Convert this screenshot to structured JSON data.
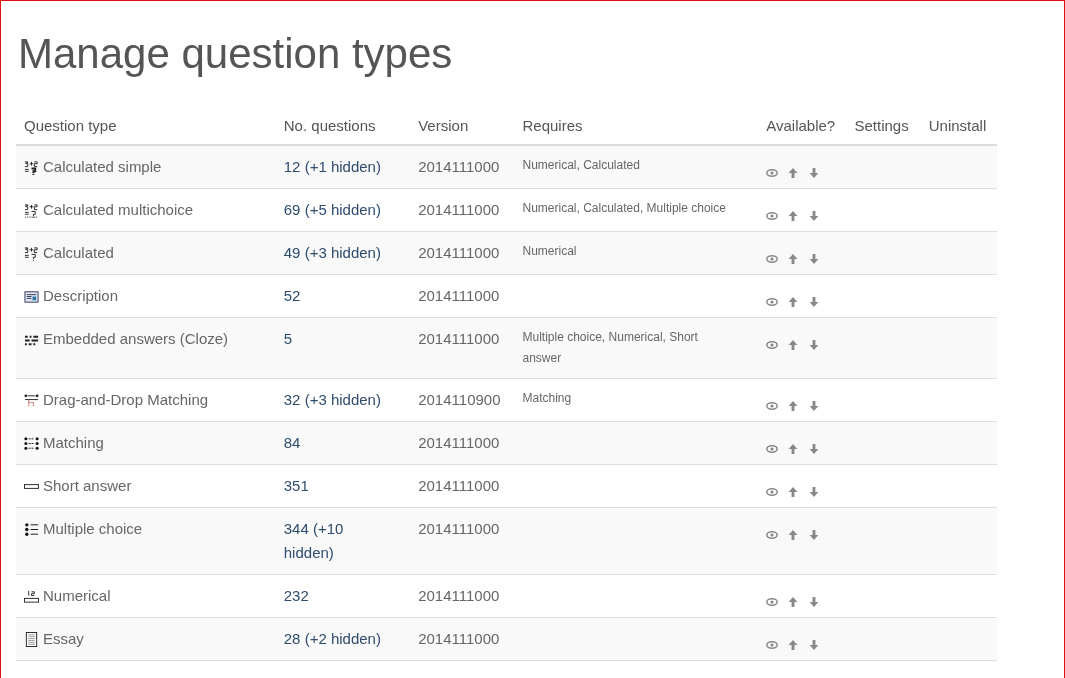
{
  "page": {
    "title": "Manage question types"
  },
  "table": {
    "columns": [
      "Question type",
      "No. questions",
      "Version",
      "Requires",
      "Available?",
      "Settings",
      "Uninstall"
    ],
    "rows": [
      {
        "kind": "calculatedsimple",
        "name": "Calculated simple",
        "count": "12 (+1 hidden)",
        "version": "2014111000",
        "requires": "Numerical, Calculated"
      },
      {
        "kind": "calculatedmulti",
        "name": "Calculated multichoice",
        "count": "69 (+5 hidden)",
        "version": "2014111000",
        "requires": "Numerical, Calculated, Multiple choice"
      },
      {
        "kind": "calculated",
        "name": "Calculated",
        "count": "49 (+3 hidden)",
        "version": "2014111000",
        "requires": "Numerical"
      },
      {
        "kind": "description",
        "name": "Description",
        "count": "52",
        "version": "2014111000"
      },
      {
        "kind": "cloze",
        "name": "Embedded answers (Cloze)",
        "count": "5",
        "version": "2014111000",
        "requires": "Multiple choice, Numerical, Short answer"
      },
      {
        "kind": "ddmatch",
        "name": "Drag-and-Drop Matching",
        "count": "32 (+3 hidden)",
        "version": "2014110900",
        "requires": "Matching"
      },
      {
        "kind": "match",
        "name": "Matching",
        "count": "84",
        "version": "2014111000"
      },
      {
        "kind": "shortanswer",
        "name": "Short answer",
        "count": "351",
        "version": "2014111000"
      },
      {
        "kind": "multichoice",
        "name": "Multiple choice",
        "count": "344 (+10 hidden)",
        "version": "2014111000"
      },
      {
        "kind": "numerical",
        "name": "Numerical",
        "count": "232",
        "version": "2014111000"
      },
      {
        "kind": "essay",
        "name": "Essay",
        "count": "28 (+2 hidden)",
        "version": "2014111000"
      }
    ]
  }
}
